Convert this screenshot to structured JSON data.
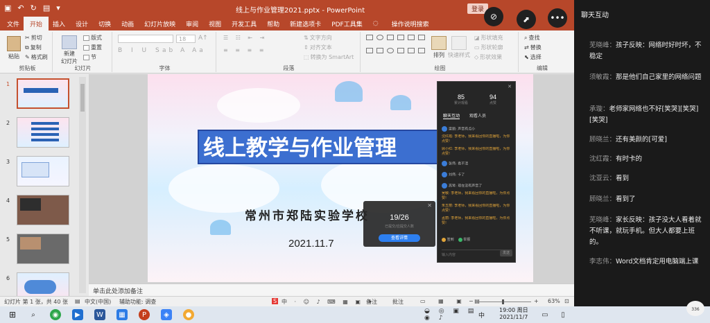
{
  "window": {
    "title": "线上与作业管理2021.pptx - PowerPoint",
    "login_label": "登录",
    "qat_icons": [
      "save-icon",
      "undo-icon",
      "redo-icon",
      "present-icon",
      "dropdown-icon"
    ]
  },
  "tabs": [
    "文件",
    "开始",
    "插入",
    "设计",
    "切换",
    "动画",
    "幻灯片放映",
    "审阅",
    "视图",
    "开发工具",
    "帮助",
    "新建选项卡",
    "PDF工具集"
  ],
  "tell_me": "操作说明搜索",
  "ribbon": {
    "clipboard": {
      "paste": "粘贴",
      "cut": "剪切",
      "copy": "复制",
      "format_painter": "格式刷",
      "label": "剪贴板"
    },
    "slides": {
      "new_slide": "新建",
      "new_slide2": "幻灯片",
      "layout": "版式",
      "reset": "重置",
      "section": "节",
      "label": "幻灯片"
    },
    "font": {
      "size": "18",
      "label": "字体"
    },
    "paragraph": {
      "text_direction": "文字方向",
      "align_text": "对齐文本",
      "smartart": "转换为 SmartArt",
      "label": "段落"
    },
    "drawing": {
      "arrange": "排列",
      "quick_styles": "快速样式",
      "shape_fill": "形状填充",
      "shape_outline": "形状轮廓",
      "shape_effects": "形状效果",
      "label": "绘图"
    },
    "editing": {
      "find": "查找",
      "replace": "替换",
      "select": "选择",
      "label": "编辑"
    }
  },
  "thumbnails": [
    "1",
    "2",
    "3",
    "4",
    "5",
    "6"
  ],
  "slide": {
    "title": "线上教学与作业管理",
    "school": "常州市郑陆实验学校",
    "date": "2021.11.7"
  },
  "vote_popup": {
    "count": "19/26",
    "sub": "已提交/应提交人数",
    "button": "查看详情"
  },
  "chat_panel": {
    "stats": [
      {
        "value": "85",
        "label": "累计观看"
      },
      {
        "value": "94",
        "label": "点赞"
      }
    ],
    "tabs": [
      "聊天互动",
      "观看人员"
    ],
    "lines": [
      {
        "text": "梁丽: 声音有点小",
        "color": "white"
      },
      {
        "text": "沈红霞: 李老师，我来看回你的直播啦，为你点赞!",
        "color": "orange"
      },
      {
        "text": "顾小红: 李老师，我来看回你的直播啦，为你点赞!",
        "color": "orange"
      },
      {
        "text": "张伟: 看不清",
        "color": "white"
      },
      {
        "text": "刘伟: 卡了",
        "color": "white"
      },
      {
        "text": "高琴: 现在没有声音了",
        "color": "white"
      },
      {
        "text": "吴敏: 李老师，我来看回你的直播啦，为你点赞!",
        "color": "orange"
      },
      {
        "text": "朱五丽: 李老师，我来看回你的直播啦，为你点赞!",
        "color": "orange"
      },
      {
        "text": "孟丽: 李老师，我来看回你的直播啦，为你点赞!",
        "color": "orange"
      }
    ],
    "foot_items": [
      "签到",
      "举报"
    ],
    "input_placeholder": "输入内容",
    "send": "发送"
  },
  "notes": "单击此处添加备注",
  "status": {
    "slide_of": "幻灯片 第 1 张，共 40 张",
    "language": "中文(中国)",
    "accessibility": "辅助功能: 调查",
    "notes_btn": "备注",
    "comments_btn": "批注",
    "zoom": "63%"
  },
  "taskbar": {
    "time": "19:00 周日",
    "date": "2021/11/7",
    "ime": "中"
  },
  "side_chat": {
    "header": "聊天互动",
    "messages": [
      {
        "who": "芜晓峰：",
        "text": "孩子反映：网络时好时坏，不稳定"
      },
      {
        "who": "须敏霞：",
        "text": "那是他们自己家里的网络问题"
      },
      {
        "who": "承璇：",
        "text": "老师家网络也不好[笑哭][笑哭][笑哭]"
      },
      {
        "who": "顾晓兰：",
        "text": "还有美颜的[可爱]"
      },
      {
        "who": "沈红霞：",
        "text": "有时卡的"
      },
      {
        "who": "沈亚云：",
        "text": "看到"
      },
      {
        "who": "顾晓兰：",
        "text": "看到了"
      },
      {
        "who": "芜晓峰：",
        "text": "家长反映：孩子没大人看着就不听课，就玩手机。但大人都要上班的。"
      },
      {
        "who": "李志伟：",
        "text": "Word文档肯定用电脑端上课"
      }
    ],
    "badge": "336"
  }
}
